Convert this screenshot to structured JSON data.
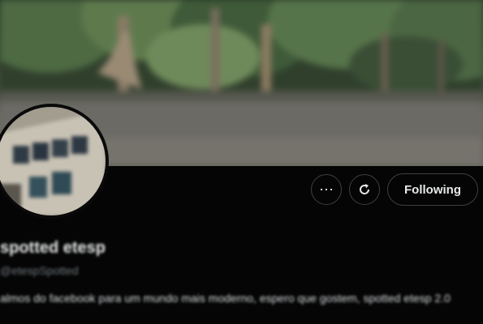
{
  "profile": {
    "display_name": "spotted etesp",
    "handle": "@etespSpotted",
    "bio": "almos do facebook para um mundo mais moderno, espero que gostem, spotted etesp 2.0",
    "avatar_icon": "notebook-photo-avatar",
    "banner_icon": "park-photo-banner"
  },
  "actions": {
    "more_icon": "more-options-icon",
    "more_glyph": "⋯",
    "notify_icon": "notification-refresh-icon",
    "following_label": "Following"
  },
  "colors": {
    "background": "#050505",
    "text_primary": "#e7e9ea",
    "text_secondary": "#6f767b",
    "button_border": "#3c4043"
  }
}
